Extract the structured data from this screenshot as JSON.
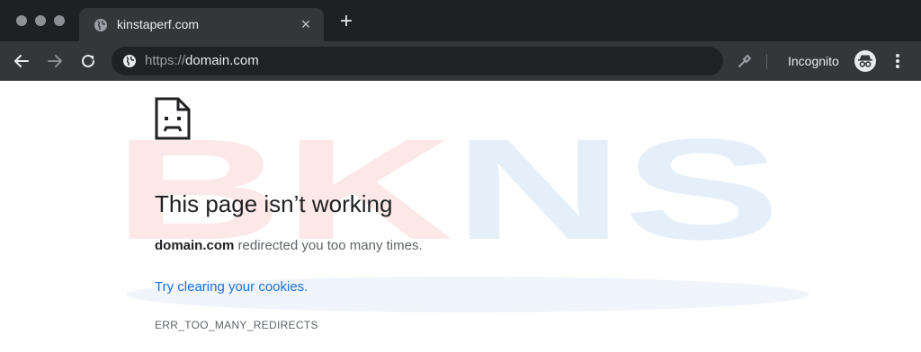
{
  "tab": {
    "title": "kinstaperf.com",
    "close_glyph": "×",
    "new_tab_glyph": "+"
  },
  "omnibox": {
    "scheme": "https://",
    "host": "domain.com"
  },
  "toolbar": {
    "incognito_label": "Incognito"
  },
  "icons": {
    "back": "arrow-left-icon",
    "forward": "arrow-right-icon",
    "reload": "reload-icon",
    "globe": "globe-icon",
    "extension": "eyedropper-icon",
    "incognito": "incognito-icon",
    "menu": "kebab-menu-icon"
  },
  "watermark": {
    "text": "BKNS",
    "colors": [
      "#fde8e8",
      "#e4effa"
    ]
  },
  "error": {
    "title": "This page isn’t working",
    "domain": "domain.com",
    "message": " redirected you too many times.",
    "link": "Try clearing your cookies.",
    "code": "ERR_TOO_MANY_REDIRECTS"
  },
  "colors": {
    "titlebar": "#1f2023",
    "toolbar": "#35363a",
    "link": "#1a73e8"
  }
}
